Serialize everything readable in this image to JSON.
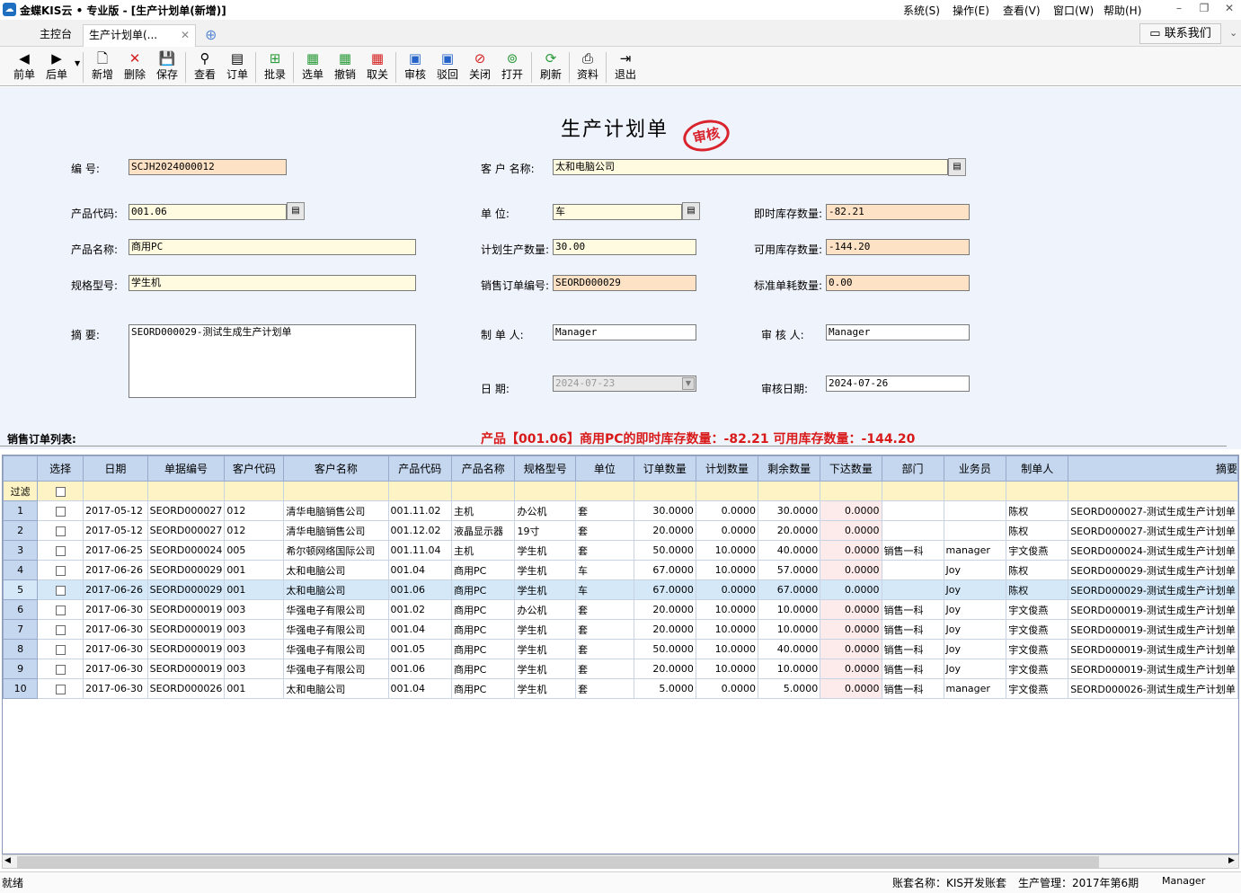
{
  "window": {
    "title": "金蝶KIS云 • 专业版 - [生产计划单(新增)]",
    "menus": [
      "系统(S)",
      "操作(E)",
      "查看(V)",
      "窗口(W)",
      "帮助(H)"
    ]
  },
  "tabs": {
    "home": "主控台",
    "active": "生产计划单(...",
    "contact": "联系我们"
  },
  "toolbar": {
    "prev": "前单",
    "next": "后单",
    "new": "新增",
    "delete": "删除",
    "save": "保存",
    "view": "查看",
    "order": "订单",
    "batch": "批录",
    "select": "选单",
    "revoke": "撤销",
    "unlink": "取关",
    "audit": "审核",
    "reject": "驳回",
    "close": "关闭",
    "open": "打开",
    "refresh": "刷新",
    "info": "资料",
    "exit": "退出"
  },
  "form": {
    "title": "生产计划单",
    "stamp": "审核",
    "number_label": "编    号:",
    "number": "SCJH2024000012",
    "customer_label": "客 户 名称:",
    "customer": "太和电脑公司",
    "product_code_label": "产品代码:",
    "product_code": "001.06",
    "unit_label": "单     位:",
    "unit": "车",
    "stock_now_label": "即时库存数量:",
    "stock_now": "-82.21",
    "product_name_label": "产品名称:",
    "product_name": "商用PC",
    "plan_qty_label": "计划生产数量:",
    "plan_qty": "30.00",
    "stock_avail_label": "可用库存数量:",
    "stock_avail": "-144.20",
    "spec_label": "规格型号:",
    "spec": "学生机",
    "sales_order_label": "销售订单编号:",
    "sales_order": "SEORD000029",
    "std_usage_label": "标准单耗数量:",
    "std_usage": "0.00",
    "memo_label": "摘     要:",
    "memo": "SEORD000029-测试生成生产计划单",
    "maker_label": "制  单  人:",
    "maker": "Manager",
    "auditor_label": "审  核  人:",
    "auditor": "Manager",
    "date_label": "日     期:",
    "date": "2024-07-23",
    "audit_date_label": "审核日期:",
    "audit_date": "2024-07-26"
  },
  "list_label": "销售订单列表:",
  "warning": "产品【001.06】商用PC的即时库存数量：-82.21 可用库存数量：-144.20",
  "grid": {
    "headers": [
      "选择",
      "日期",
      "单据编号",
      "客户代码",
      "客户名称",
      "产品代码",
      "产品名称",
      "规格型号",
      "单位",
      "订单数量",
      "计划数量",
      "剩余数量",
      "下达数量",
      "部门",
      "业务员",
      "制单人",
      "摘要"
    ],
    "filter_label": "过滤",
    "rows": [
      {
        "n": "1",
        "date": "2017-05-12",
        "no": "SEORD000027",
        "cc": "012",
        "cust": "清华电脑销售公司",
        "pc": "001.11.02",
        "pn": "主机",
        "spec": "办公机",
        "unit": "套",
        "oq": "30.0000",
        "pq": "0.0000",
        "rq": "30.0000",
        "iq": "0.0000",
        "dept": "",
        "sales": "",
        "maker": "陈权",
        "memo": "SEORD000027-测试生成生产计划单"
      },
      {
        "n": "2",
        "date": "2017-05-12",
        "no": "SEORD000027",
        "cc": "012",
        "cust": "清华电脑销售公司",
        "pc": "001.12.02",
        "pn": "液晶显示器",
        "spec": "19寸",
        "unit": "套",
        "oq": "20.0000",
        "pq": "0.0000",
        "rq": "20.0000",
        "iq": "0.0000",
        "dept": "",
        "sales": "",
        "maker": "陈权",
        "memo": "SEORD000027-测试生成生产计划单"
      },
      {
        "n": "3",
        "date": "2017-06-25",
        "no": "SEORD000024",
        "cc": "005",
        "cust": "希尔顿网络国际公司",
        "pc": "001.11.04",
        "pn": "主机",
        "spec": "学生机",
        "unit": "套",
        "oq": "50.0000",
        "pq": "10.0000",
        "rq": "40.0000",
        "iq": "0.0000",
        "dept": "销售一科",
        "sales": "manager",
        "maker": "宇文俊燕",
        "memo": "SEORD000024-测试生成生产计划单"
      },
      {
        "n": "4",
        "date": "2017-06-26",
        "no": "SEORD000029",
        "cc": "001",
        "cust": "太和电脑公司",
        "pc": "001.04",
        "pn": "商用PC",
        "spec": "学生机",
        "unit": "车",
        "oq": "67.0000",
        "pq": "10.0000",
        "rq": "57.0000",
        "iq": "0.0000",
        "dept": "",
        "sales": "Joy",
        "maker": "陈权",
        "memo": "SEORD000029-测试生成生产计划单"
      },
      {
        "n": "5",
        "date": "2017-06-26",
        "no": "SEORD000029",
        "cc": "001",
        "cust": "太和电脑公司",
        "pc": "001.06",
        "pn": "商用PC",
        "spec": "学生机",
        "unit": "车",
        "oq": "67.0000",
        "pq": "0.0000",
        "rq": "67.0000",
        "iq": "0.0000",
        "dept": "",
        "sales": "Joy",
        "maker": "陈权",
        "memo": "SEORD000029-测试生成生产计划单"
      },
      {
        "n": "6",
        "date": "2017-06-30",
        "no": "SEORD000019",
        "cc": "003",
        "cust": "华强电子有限公司",
        "pc": "001.02",
        "pn": "商用PC",
        "spec": "办公机",
        "unit": "套",
        "oq": "20.0000",
        "pq": "10.0000",
        "rq": "10.0000",
        "iq": "0.0000",
        "dept": "销售一科",
        "sales": "Joy",
        "maker": "宇文俊燕",
        "memo": "SEORD000019-测试生成生产计划单"
      },
      {
        "n": "7",
        "date": "2017-06-30",
        "no": "SEORD000019",
        "cc": "003",
        "cust": "华强电子有限公司",
        "pc": "001.04",
        "pn": "商用PC",
        "spec": "学生机",
        "unit": "套",
        "oq": "20.0000",
        "pq": "10.0000",
        "rq": "10.0000",
        "iq": "0.0000",
        "dept": "销售一科",
        "sales": "Joy",
        "maker": "宇文俊燕",
        "memo": "SEORD000019-测试生成生产计划单"
      },
      {
        "n": "8",
        "date": "2017-06-30",
        "no": "SEORD000019",
        "cc": "003",
        "cust": "华强电子有限公司",
        "pc": "001.05",
        "pn": "商用PC",
        "spec": "学生机",
        "unit": "套",
        "oq": "50.0000",
        "pq": "10.0000",
        "rq": "40.0000",
        "iq": "0.0000",
        "dept": "销售一科",
        "sales": "Joy",
        "maker": "宇文俊燕",
        "memo": "SEORD000019-测试生成生产计划单"
      },
      {
        "n": "9",
        "date": "2017-06-30",
        "no": "SEORD000019",
        "cc": "003",
        "cust": "华强电子有限公司",
        "pc": "001.06",
        "pn": "商用PC",
        "spec": "学生机",
        "unit": "套",
        "oq": "20.0000",
        "pq": "10.0000",
        "rq": "10.0000",
        "iq": "0.0000",
        "dept": "销售一科",
        "sales": "Joy",
        "maker": "宇文俊燕",
        "memo": "SEORD000019-测试生成生产计划单"
      },
      {
        "n": "10",
        "date": "2017-06-30",
        "no": "SEORD000026",
        "cc": "001",
        "cust": "太和电脑公司",
        "pc": "001.04",
        "pn": "商用PC",
        "spec": "学生机",
        "unit": "套",
        "oq": "5.0000",
        "pq": "0.0000",
        "rq": "5.0000",
        "iq": "0.0000",
        "dept": "销售一科",
        "sales": "manager",
        "maker": "宇文俊燕",
        "memo": "SEORD000026-测试生成生产计划单"
      }
    ],
    "selected_row": "5"
  },
  "status": {
    "ready": "就绪",
    "account": "账套名称：KIS开发账套",
    "period": "生产管理：2017年第6期",
    "user": "Manager"
  }
}
